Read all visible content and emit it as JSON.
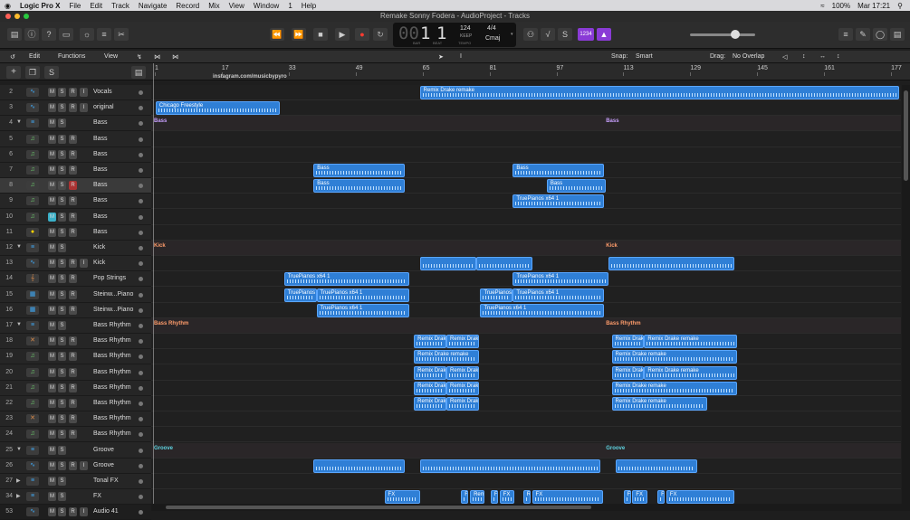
{
  "menubar": {
    "apple": "",
    "app": "Logic Pro X",
    "items": [
      "File",
      "Edit",
      "Track",
      "Navigate",
      "Record",
      "Mix",
      "View",
      "Window",
      "1",
      "Help"
    ],
    "battery": "100%",
    "clock": "Mar 17:21"
  },
  "window": {
    "title": "Remake Sonny Fodera - AudioProject - Tracks"
  },
  "lcd": {
    "bar": "1",
    "beat": "1",
    "bar_label": "BAR",
    "beat_label": "BEAT",
    "tempo": "124",
    "tempo_label": "KEEP",
    "tempo_sub": "TEMPO",
    "sig": "4/4",
    "key": "Cmaj",
    "pre": "00"
  },
  "toolbar": {
    "count_in": "1234"
  },
  "editbar": {
    "edit": "Edit",
    "functions": "Functions",
    "view": "View",
    "snap_label": "Snap:",
    "snap_value": "Smart",
    "drag_label": "Drag:",
    "drag_value": "No Overlap"
  },
  "ruler": {
    "bars": [
      "1",
      "17",
      "33",
      "49",
      "65",
      "81",
      "97",
      "113",
      "129",
      "145",
      "161",
      "177"
    ],
    "annotation": "instagram.com/musicbypyro"
  },
  "accent": "#2f7fd6",
  "tracks": [
    {
      "num": "2",
      "name": "Vocals",
      "icon": "audio-wave-icon",
      "mute": "M",
      "solo": "S",
      "rec": "R",
      "input": "I"
    },
    {
      "num": "3",
      "name": "original",
      "icon": "audio-wave-icon",
      "mute": "M",
      "solo": "S",
      "rec": "R",
      "input": "I"
    },
    {
      "num": "4",
      "name": "Bass",
      "icon": "track-stack-icon",
      "mute": "M",
      "solo": "S",
      "disclosure": "▼"
    },
    {
      "num": "5",
      "name": "Bass",
      "icon": "midi-note-icon",
      "mute": "M",
      "solo": "S",
      "rec": "R"
    },
    {
      "num": "6",
      "name": "Bass",
      "icon": "midi-note-icon",
      "mute": "M",
      "solo": "S",
      "rec": "R"
    },
    {
      "num": "7",
      "name": "Bass",
      "icon": "midi-note-icon",
      "mute": "M",
      "solo": "S",
      "rec": "R"
    },
    {
      "num": "8",
      "name": "Bass",
      "icon": "midi-note-icon",
      "mute": "M",
      "solo": "S",
      "rec": "R"
    },
    {
      "num": "9",
      "name": "Bass",
      "icon": "midi-note-icon",
      "mute": "M",
      "solo": "S",
      "rec": "R"
    },
    {
      "num": "10",
      "name": "Bass",
      "icon": "midi-note-icon",
      "mute": "M",
      "solo": "S",
      "rec": "R"
    },
    {
      "num": "11",
      "name": "Bass",
      "icon": "yellow-face-icon",
      "mute": "M",
      "solo": "S",
      "rec": "R"
    },
    {
      "num": "12",
      "name": "Kick",
      "icon": "track-stack-icon",
      "mute": "M",
      "solo": "S",
      "disclosure": "▼"
    },
    {
      "num": "13",
      "name": "Kick",
      "icon": "audio-wave-icon",
      "mute": "M",
      "solo": "S",
      "rec": "R",
      "input": "I"
    },
    {
      "num": "14",
      "name": "Pop Strings",
      "icon": "strings-icon",
      "mute": "M",
      "solo": "S",
      "rec": "R"
    },
    {
      "num": "15",
      "name": "Steinw...Piano",
      "icon": "piano-icon",
      "mute": "M",
      "solo": "S",
      "rec": "R"
    },
    {
      "num": "16",
      "name": "Steinw...Piano",
      "icon": "piano-icon",
      "mute": "M",
      "solo": "S",
      "rec": "R"
    },
    {
      "num": "17",
      "name": "Bass Rhythm",
      "icon": "track-stack-icon",
      "mute": "M",
      "solo": "S",
      "disclosure": "▼"
    },
    {
      "num": "18",
      "name": "Bass Rhythm",
      "icon": "drum-icon",
      "mute": "M",
      "solo": "S",
      "rec": "R"
    },
    {
      "num": "19",
      "name": "Bass Rhythm",
      "icon": "midi-note-icon",
      "mute": "M",
      "solo": "S",
      "rec": "R"
    },
    {
      "num": "20",
      "name": "Bass Rhythm",
      "icon": "midi-note-icon",
      "mute": "M",
      "solo": "S",
      "rec": "R"
    },
    {
      "num": "21",
      "name": "Bass Rhythm",
      "icon": "midi-note-icon",
      "mute": "M",
      "solo": "S",
      "rec": "R"
    },
    {
      "num": "22",
      "name": "Bass Rhythm",
      "icon": "midi-note-icon",
      "mute": "M",
      "solo": "S",
      "rec": "R"
    },
    {
      "num": "23",
      "name": "Bass Rhythm",
      "icon": "drum-icon",
      "mute": "M",
      "solo": "S",
      "rec": "R"
    },
    {
      "num": "24",
      "name": "Bass Rhythm",
      "icon": "midi-note-icon",
      "mute": "M",
      "solo": "S",
      "rec": "R"
    },
    {
      "num": "25",
      "name": "Groove",
      "icon": "track-stack-icon",
      "mute": "M",
      "solo": "S",
      "disclosure": "▼"
    },
    {
      "num": "26",
      "name": "Groove",
      "icon": "audio-wave-icon",
      "mute": "M",
      "solo": "S",
      "rec": "R",
      "input": "I"
    },
    {
      "num": "27",
      "name": "Tonal FX",
      "icon": "track-stack-icon",
      "mute": "M",
      "solo": "S",
      "disclosure": "▶"
    },
    {
      "num": "34",
      "name": "FX",
      "icon": "track-stack-icon",
      "mute": "M",
      "solo": "S",
      "disclosure": "▶"
    },
    {
      "num": "53",
      "name": "Audio 41",
      "icon": "audio-wave-icon",
      "mute": "M",
      "solo": "S",
      "rec": "R",
      "input": "I"
    }
  ],
  "stack_labels": [
    {
      "row": 2,
      "text": "Bass",
      "color": "#c9a0ff"
    },
    {
      "row": 10,
      "text": "Kick",
      "color": "#ff9c6b"
    },
    {
      "row": 15,
      "text": "Bass Rhythm",
      "color": "#ff9c6b"
    },
    {
      "row": 23,
      "text": "Groove",
      "color": "#5fd3e0"
    }
  ],
  "regions": [
    {
      "row": 0,
      "start": 18.2,
      "len": 32.5,
      "label": "Remix Drake remake"
    },
    {
      "row": 1,
      "start": 0.3,
      "len": 8.4,
      "label": "Chicago Freestyle"
    },
    {
      "row": 5,
      "start": 11.0,
      "len": 6.2,
      "label": "Bass"
    },
    {
      "row": 5,
      "start": 24.5,
      "len": 6.2,
      "label": "Bass"
    },
    {
      "row": 6,
      "start": 11.0,
      "len": 6.2,
      "label": "Bass"
    },
    {
      "row": 6,
      "start": 26.8,
      "len": 4.0,
      "label": "Bass"
    },
    {
      "row": 7,
      "start": 24.5,
      "len": 6.2,
      "label": "TruePianos x64 1"
    },
    {
      "row": 11,
      "start": 18.2,
      "len": 3.8,
      "label": ""
    },
    {
      "row": 11,
      "start": 22.0,
      "len": 3.8,
      "label": ""
    },
    {
      "row": 11,
      "start": 31.0,
      "len": 8.5,
      "label": ""
    },
    {
      "row": 12,
      "start": 9.0,
      "len": 8.5,
      "label": "TruePianos x64 1"
    },
    {
      "row": 12,
      "start": 24.5,
      "len": 6.5,
      "label": "TruePianos x64 1"
    },
    {
      "row": 13,
      "start": 9.0,
      "len": 2.2,
      "label": "TruePianos"
    },
    {
      "row": 13,
      "start": 11.2,
      "len": 6.3,
      "label": "TruePianos x64 1"
    },
    {
      "row": 13,
      "start": 22.3,
      "len": 2.2,
      "label": "TruePianos"
    },
    {
      "row": 13,
      "start": 24.5,
      "len": 6.2,
      "label": "TruePianos x64 1"
    },
    {
      "row": 14,
      "start": 11.2,
      "len": 6.3,
      "label": "TruePianos x64 1"
    },
    {
      "row": 14,
      "start": 22.3,
      "len": 8.4,
      "label": "TruePianos x64 1"
    },
    {
      "row": 16,
      "start": 17.8,
      "len": 2.2,
      "label": "Remix Drak"
    },
    {
      "row": 16,
      "start": 20.0,
      "len": 2.2,
      "label": "Remix Drak"
    },
    {
      "row": 16,
      "start": 31.2,
      "len": 2.2,
      "label": "Remix Drak"
    },
    {
      "row": 16,
      "start": 33.4,
      "len": 6.3,
      "label": "Remix Drake remake"
    },
    {
      "row": 17,
      "start": 17.8,
      "len": 4.4,
      "label": "Remix Drake remake"
    },
    {
      "row": 17,
      "start": 31.2,
      "len": 8.5,
      "label": "Remix Drake remake"
    },
    {
      "row": 18,
      "start": 17.8,
      "len": 2.2,
      "label": "Remix Drak"
    },
    {
      "row": 18,
      "start": 20.0,
      "len": 2.2,
      "label": "Remix Drak"
    },
    {
      "row": 18,
      "start": 31.2,
      "len": 2.2,
      "label": "Remix Drak"
    },
    {
      "row": 18,
      "start": 33.4,
      "len": 6.3,
      "label": "Remix Drake remake"
    },
    {
      "row": 19,
      "start": 17.8,
      "len": 2.2,
      "label": "Remix Drak"
    },
    {
      "row": 19,
      "start": 20.0,
      "len": 2.2,
      "label": "Remix Drak"
    },
    {
      "row": 19,
      "start": 31.2,
      "len": 8.5,
      "label": "Remix Drake remake"
    },
    {
      "row": 20,
      "start": 17.8,
      "len": 2.2,
      "label": "Remix Drak"
    },
    {
      "row": 20,
      "start": 20.0,
      "len": 2.2,
      "label": "Remix Drak"
    },
    {
      "row": 20,
      "start": 31.2,
      "len": 6.5,
      "label": "Remix Drake remake"
    },
    {
      "row": 24,
      "start": 11.0,
      "len": 6.2,
      "label": ""
    },
    {
      "row": 24,
      "start": 18.2,
      "len": 12.2,
      "label": ""
    },
    {
      "row": 24,
      "start": 31.5,
      "len": 5.5,
      "label": ""
    },
    {
      "row": 26,
      "start": 15.8,
      "len": 2.4,
      "label": "FX"
    },
    {
      "row": 26,
      "start": 21.0,
      "len": 0.5,
      "label": "F"
    },
    {
      "row": 26,
      "start": 21.6,
      "len": 1.0,
      "label": "Remi"
    },
    {
      "row": 26,
      "start": 23.0,
      "len": 0.5,
      "label": "F"
    },
    {
      "row": 26,
      "start": 23.6,
      "len": 1.0,
      "label": "FX"
    },
    {
      "row": 26,
      "start": 25.2,
      "len": 0.5,
      "label": "R"
    },
    {
      "row": 26,
      "start": 25.8,
      "len": 4.8,
      "label": "FX"
    },
    {
      "row": 26,
      "start": 32.0,
      "len": 0.5,
      "label": "F"
    },
    {
      "row": 26,
      "start": 32.6,
      "len": 1.0,
      "label": "FX"
    },
    {
      "row": 26,
      "start": 34.3,
      "len": 0.5,
      "label": "F"
    },
    {
      "row": 26,
      "start": 34.9,
      "len": 4.6,
      "label": "FX"
    }
  ]
}
